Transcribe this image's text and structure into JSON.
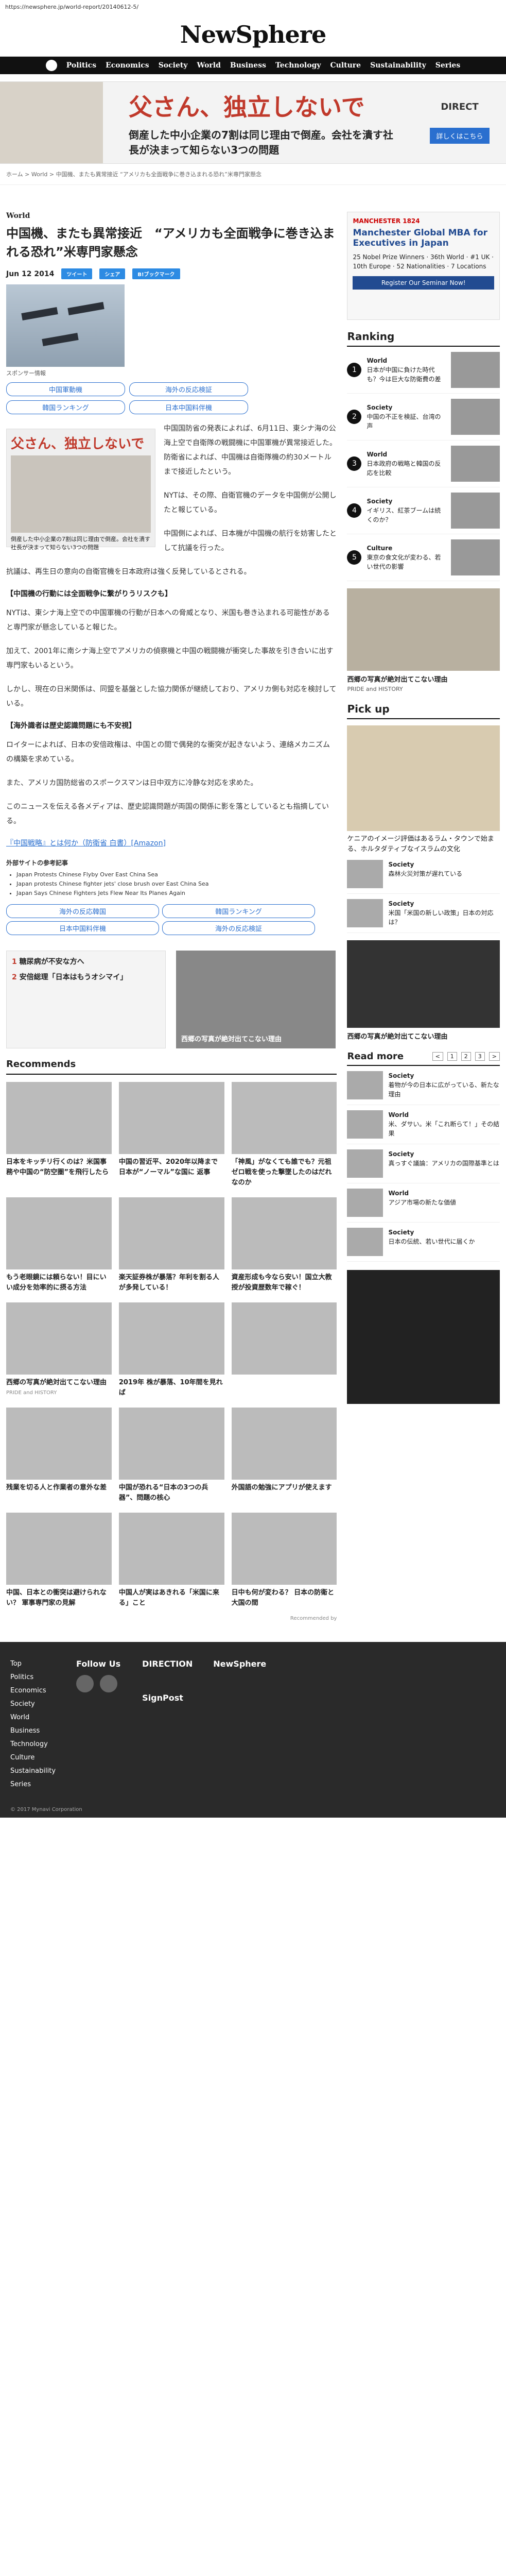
{
  "url": "https://newsphere.jp/world-report/20140612-5/",
  "brand": "NewSphere",
  "nav": [
    "Politics",
    "Economics",
    "Society",
    "World",
    "Business",
    "Technology",
    "Culture",
    "Sustainability",
    "Series"
  ],
  "top_ad": {
    "headline": "父さん、独立しないで",
    "sub": "倒産した中小企業の7割は同じ理由で倒産。会社を潰す社長が決まって知らない3つの問題",
    "brand": "DIRECT",
    "button": "詳しくはこちら"
  },
  "breadcrumb": "ホーム > World > 中国機、またも異常接近 “アメリカも全面戦争に巻き込まれる恐れ”米専門家懸念",
  "article": {
    "category": "World",
    "title": "中国機、またも異常接近　“アメリカも全面戦争に巻き込まれる恐れ”米専門家懸念",
    "date": "Jun 12 2014",
    "share": [
      "ツイート",
      "シェア",
      "B!ブックマーク"
    ],
    "caption": "スポンサー情報",
    "pills": [
      "中国軍動機",
      "海外の反応検証",
      "韓国ランキング",
      "日本中国料伴機"
    ],
    "inad_title": "父さん、独立しないで",
    "inad_sub": "倒産した中小企業の7割は同じ理由で倒産。会社を潰す社長が決まって知らない3つの問題",
    "paragraphs": [
      "中国国防省の発表によれば、6月11日、東シナ海の公海上空で自衛隊の戦闘機に中国軍機が異常接近した。防衛省によれば、中国機は自衛隊機の約30メートルまで接近したという。",
      "NYTは、その際、自衛官機のデータを中国側が公開したと報じている。",
      "中国側によれば、日本機が中国機の航行を妨害したとして抗議を行った。",
      "抗議は、再生日の意向の自衛官機を日本政府は強く反発しているとされる。"
    ],
    "h3_1": "【中国機の行動には全面戦争に繋がりうリスクも】",
    "p_more": [
      "NYTは、東シナ海上空での中国軍機の行動が日本への脅威となり、米国も巻き込まれる可能性があると専門家が懸念していると報じた。",
      "加えて、2001年に南シナ海上空でアメリカの偵察機と中国の戦闘機が衝突した事故を引き合いに出す専門家もいるという。",
      "しかし、現在の日米関係は、同盟を基盤とした協力関係が継続しており、アメリカ側も対応を検討している。"
    ],
    "h3_2": "【海外識者は歴史認識問題にも不安視】",
    "p_more2": [
      "ロイターによれば、日本の安倍政権は、中国との間で偶発的な衝突が起きないよう、連絡メカニズムの構築を求めている。",
      "また、アメリカ国防総省のスポークスマンは日中双方に冷静な対応を求めた。",
      "このニュースを伝える各メディアは、歴史認識問題が両国の関係に影を落としているとも指摘している。"
    ],
    "link": "『中国戦略』とは何か（防衛省 白書）[Amazon]",
    "src_label": "外部サイトの参考記事",
    "src_items": [
      "Japan Protests Chinese Flyby Over East China Sea",
      "Japan protests Chinese fighter jets' close brush over East China Sea",
      "Japan Says Chinese Fighters Jets Flew Near Its Planes Again"
    ],
    "pills2": [
      "海外の反応韓国",
      "韓国ランキング",
      "日本中国料伴機",
      "海外の反応検証"
    ],
    "ad_rows": [
      {
        "num": "1",
        "text": "糖尿病が不安な方へ"
      },
      {
        "num": "2",
        "text": "安倍総理「日本はもうオシマイ」"
      }
    ],
    "ad_image_caption": "西郷の写真が絶対出てこない理由"
  },
  "recommends": {
    "title": "Recommends",
    "cards": [
      {
        "title": "日本をキッチリ行くのは？米国事務や中国の“防空圏”を飛行したら",
        "src": ""
      },
      {
        "title": "中国の習近平、2020年以降まで日本が“ノーマル”な国に 返事",
        "src": ""
      },
      {
        "title": "「神風」がなくても誰でも？元祖ゼロ戦を使った撃墜したのはだれなのか",
        "src": ""
      },
      {
        "title": "もう老眼鏡には頼らない！目にいい成分を効率的に摂る方法",
        "src": ""
      },
      {
        "title": "楽天証券株が暴落？年利を割る人が多発している！",
        "src": ""
      },
      {
        "title": "資産形成も今なら安い！国立大教授が投資歴数年で稼ぐ！",
        "src": ""
      },
      {
        "title": "西郷の写真が絶対出てこない理由",
        "src": "PRIDE and HISTORY"
      },
      {
        "title": "2019年 株が暴落、10年間を見れば",
        "src": ""
      },
      {
        "title": "",
        "src": ""
      },
      {
        "title": "残業を切る人と作業者の意外な差",
        "src": ""
      },
      {
        "title": "中国が恐れる“日本の3つの兵器”、問題の核心",
        "src": ""
      },
      {
        "title": "外国語の勉強にアプリが使えます",
        "src": ""
      },
      {
        "title": "中国、日本との衝突は避けられない？ 軍事専門家の見解",
        "src": ""
      },
      {
        "title": "中国人が実はあきれる「米国に来る」こと",
        "src": ""
      },
      {
        "title": "日中も何が変わる？ 日本の防衛と大国の間",
        "src": ""
      }
    ],
    "powered": "Recommended by"
  },
  "sidebar": {
    "mbs": {
      "org": "MANCHESTER 1824",
      "title": "Manchester Global MBA for Executives in Japan",
      "lines": "25 Nobel Prize Winners · 36th World · #1 UK · 10th Europe · 52 Nationalities · 7 Locations",
      "button": "Register Our Seminar Now!"
    },
    "ranking_title": "Ranking",
    "ranking": [
      {
        "num": "1",
        "cat": "World",
        "text": "日本が中国に負けた時代も？今は巨大な防衛費の差"
      },
      {
        "num": "2",
        "cat": "Society",
        "text": "中国の不正を検証、台湾の声"
      },
      {
        "num": "3",
        "cat": "World",
        "text": "日本政府の戦略と韓国の反応を比較"
      },
      {
        "num": "4",
        "cat": "Society",
        "text": "イギリス、紅茶ブームは続くのか？"
      },
      {
        "num": "5",
        "cat": "Culture",
        "text": "東京の食文化が変わる、若い世代の影響"
      }
    ],
    "big_caption": "西郷の写真が絶対出てこない理由",
    "big_src": "PRIDE and HISTORY",
    "pick_title": "Pick up",
    "pick_caption": "ケニアのイメージ評価はあるラム・タウンで始まる、ホルタダティブなイスラムの文化",
    "pick_items": [
      {
        "cat": "Society",
        "text": "森林火災対策が遅れている"
      },
      {
        "cat": "Society",
        "text": "米国「米国の新しい政策」日本の対応は？"
      }
    ],
    "pick_image_caption": "西郷の写真が絶対出てこない理由",
    "readmore_title": "Read more",
    "readmore_pages": [
      "<",
      "1",
      "2",
      "3",
      ">"
    ],
    "readmore": [
      {
        "cat": "Society",
        "text": "着物が今の日本に広がっている、新たな理由"
      },
      {
        "cat": "World",
        "text": "米、ダサい。米「これ断らて！」その結果"
      },
      {
        "cat": "Society",
        "text": "真っすぐ議論：アメリカの国際基準とは"
      },
      {
        "cat": "World",
        "text": "アジア市場の新たな価値"
      },
      {
        "cat": "Society",
        "text": "日本の伝統、若い世代に届くか"
      }
    ]
  },
  "footer": {
    "col1": [
      "Top",
      "Politics",
      "Economics",
      "Society",
      "World",
      "Business",
      "Technology",
      "Culture",
      "Sustainability",
      "Series"
    ],
    "follow": "Follow Us",
    "direction": "DIRECTION",
    "signpost": "SignPost",
    "brand": "NewSphere",
    "copyright": "© 2017 Mynavi Corporation"
  }
}
